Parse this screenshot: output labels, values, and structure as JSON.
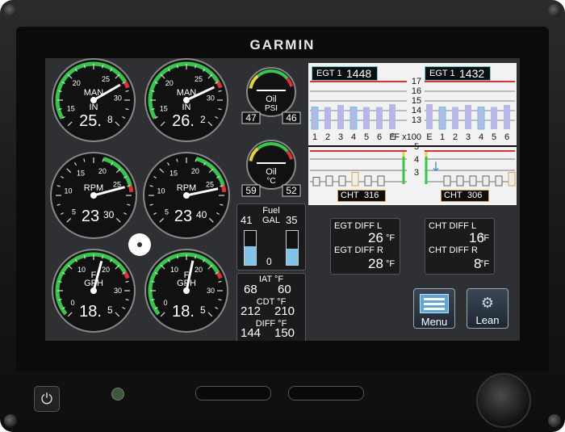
{
  "brand": "GARMIN",
  "gauges": {
    "man_left": {
      "label": "MAN",
      "unit": "IN",
      "ticks": [
        "15",
        "20",
        "25",
        "30"
      ],
      "value_main": "25.",
      "value_sup": "8"
    },
    "man_right": {
      "label": "MAN",
      "unit": "IN",
      "ticks": [
        "15",
        "20",
        "25",
        "30"
      ],
      "value_main": "26.",
      "value_sup": "2"
    },
    "rpm_left": {
      "label": "RPM",
      "ticks": [
        "5",
        "10",
        "15",
        "20",
        "25"
      ],
      "value_main": "23",
      "value_sup": "30"
    },
    "rpm_right": {
      "label": "RPM",
      "ticks": [
        "5",
        "10",
        "15",
        "20",
        "25"
      ],
      "value_main": "23",
      "value_sup": "40"
    },
    "ff_left": {
      "label": "GPH",
      "unit": "F",
      "ticks": [
        "0",
        "10",
        "20",
        "30"
      ],
      "value_main": "18.",
      "value_sup": "5"
    },
    "ff_right": {
      "label": "GPH",
      "unit": "F",
      "ticks": [
        "0",
        "10",
        "20",
        "30"
      ],
      "value_main": "18.",
      "value_sup": "5"
    }
  },
  "oil_psi": {
    "label": "Oil",
    "unit": "PSI",
    "left": "47",
    "right": "46"
  },
  "oil_temp": {
    "label": "Oil",
    "unit": "°C",
    "left": "59",
    "right": "52"
  },
  "fuel": {
    "title": "Fuel",
    "unit": "GAL",
    "left": "41",
    "right": "35",
    "zero": "0",
    "left_level": 0.55,
    "right_level": 0.48
  },
  "iat": {
    "label": "IAT °F",
    "left": "68",
    "right": "60"
  },
  "cdt": {
    "label": "CDT °F",
    "left": "212",
    "right": "210"
  },
  "diff": {
    "label": "DIFF °F",
    "left": "144",
    "right": "150"
  },
  "egt": {
    "left_label": "EGT 1",
    "left_value": "1448",
    "right_label": "EGT 1",
    "right_value": "1432",
    "scale": [
      "17",
      "16",
      "15",
      "14",
      "13"
    ],
    "cyl_left": [
      "1",
      "2",
      "3",
      "4",
      "5",
      "6",
      "E"
    ],
    "cyl_right": [
      "E",
      "1",
      "2",
      "3",
      "4",
      "5",
      "6"
    ],
    "unit": "°F x100",
    "left_bars": [
      0.55,
      0.55,
      0.6,
      0.55,
      0.55,
      0.55,
      0.62
    ],
    "right_bars": [
      0.62,
      0.55,
      0.55,
      0.6,
      0.55,
      0.55,
      0.6
    ]
  },
  "cht": {
    "scale": [
      "5",
      "4",
      "3"
    ],
    "left_label": "CHT",
    "left_value": "316",
    "right_label": "CHT",
    "right_value": "306",
    "left_bars": [
      0.35,
      0.4,
      0.4,
      0.55,
      0.4,
      0.4
    ],
    "right_bars": [
      0.4,
      0.4,
      0.4,
      0.4,
      0.4,
      0.55
    ]
  },
  "egt_diff": {
    "l_label": "EGT DIFF L",
    "l_value": "26",
    "r_label": "EGT DIFF R",
    "r_value": "28",
    "unit": "°F"
  },
  "cht_diff": {
    "l_label": "CHT DIFF L",
    "l_value": "16",
    "r_label": "CHT DIFF R",
    "r_value": "8",
    "unit": "°F"
  },
  "buttons": {
    "menu": "Menu",
    "lean": "Lean"
  },
  "colors": {
    "green": "#34c84a",
    "red": "#e03030",
    "yellow": "#e8d23a",
    "cyan": "#5ad0d8",
    "bar": "#b7b7e8",
    "amber": "#d9a24a"
  }
}
